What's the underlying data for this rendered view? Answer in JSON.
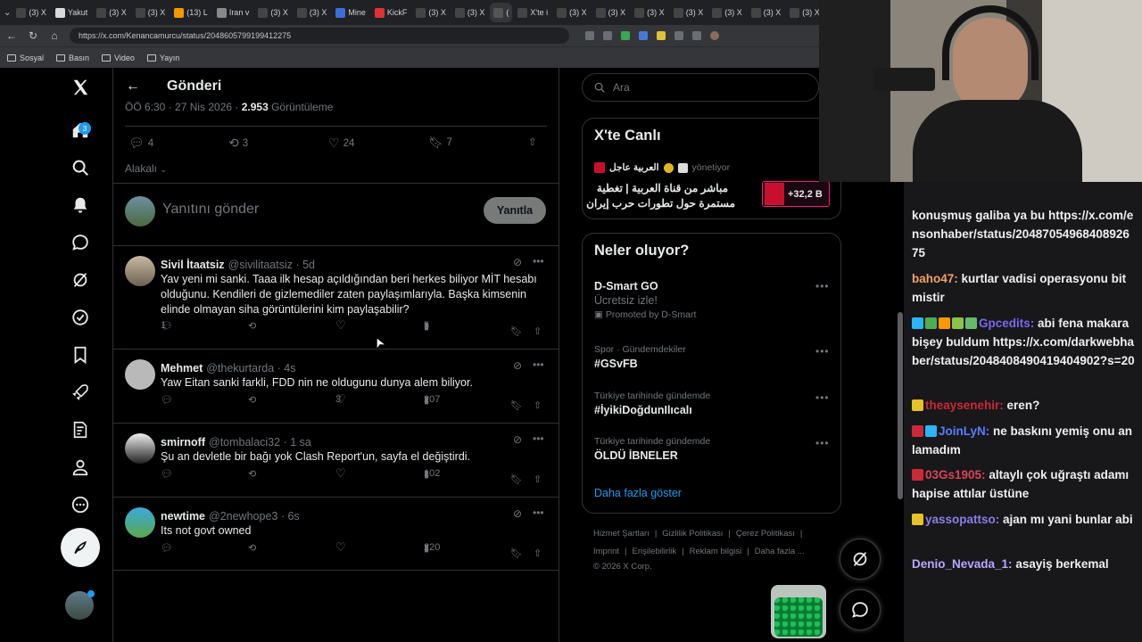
{
  "browser": {
    "tabs": [
      {
        "label": "(3) X"
      },
      {
        "label": "Yakut"
      },
      {
        "label": "(3) X"
      },
      {
        "label": "(3) X"
      },
      {
        "label": "(13) L"
      },
      {
        "label": "Iran v"
      },
      {
        "label": "(3) X"
      },
      {
        "label": "(3) X"
      },
      {
        "label": "Mine"
      },
      {
        "label": "KickF"
      },
      {
        "label": "(3) X"
      },
      {
        "label": "(3) X"
      },
      {
        "label": "("
      },
      {
        "label": "X'te i"
      },
      {
        "label": "(3) X"
      },
      {
        "label": "(3) X"
      },
      {
        "label": "(3) X"
      },
      {
        "label": "(3) X"
      },
      {
        "label": "(3) X"
      },
      {
        "label": "(3) X"
      },
      {
        "label": "(3) X"
      }
    ],
    "url": "https://x.com/Kenancamurcu/status/2048605799199412275",
    "bookmarks": [
      "Sosyal",
      "Basın",
      "Video",
      "Yayın"
    ]
  },
  "nav": {
    "notification_count": "3"
  },
  "post": {
    "header_title": "Gönderi",
    "meta": "ÖÖ 6:30 · 27 Nis 2026 · ",
    "views_count": "2.953",
    "views_label": " Görüntüleme",
    "replies": "4",
    "reposts": "3",
    "likes": "24",
    "bookmarks": "7",
    "sort_label": "Alakalı",
    "reply_placeholder": "Yanıtını gönder",
    "reply_button": "Yanıtla"
  },
  "replies": [
    {
      "name": "Sivil İtaatsiz",
      "handle": "@sivilitaatsiz · 5d",
      "lines": [
        "Yav yeni mi sanki. Taaa ilk hesap açıldığından beri herkes biliyor MİT hesabı",
        "olduğunu. Kendileri de gizlemediler zaten paylaşımlarıyla. Başka kimsenin",
        "elinde olmayan siha görüntülerini kim paylaşabilir?"
      ],
      "replies": "1",
      "likes": "",
      "views": "5"
    },
    {
      "name": "Mehmet",
      "handle": "@thekurtarda · 4s",
      "lines": [
        "Yaw Eitan sanki farkli, FDD nin ne oldugunu dunya alem biliyor."
      ],
      "replies": "",
      "likes": "3",
      "views": "207"
    },
    {
      "name": "smirnoff",
      "handle": "@tombalaci32 · 1 sa",
      "lines": [
        "Şu an devletle bir bağı yok Clash Report'un, sayfa el değiştirdi."
      ],
      "replies": "",
      "likes": "",
      "views": "102"
    },
    {
      "name": "newtime",
      "handle": "@2newhope3 · 6s",
      "lines": [
        "Its not govt owned"
      ],
      "replies": "",
      "likes": "",
      "views": "220"
    }
  ],
  "sidebar": {
    "search_placeholder": "Ara",
    "live_title": "X'te Canlı",
    "live_channel": "العربية عاجل",
    "live_status": "yönetiyor",
    "live_line1": "مباشر من قناة العربية | تغطية",
    "live_line2": "مستمرة حول تطورات حرب إيران",
    "live_count": "+32,2 B",
    "happening_title": "Neler oluyor?",
    "trends": [
      {
        "context": "",
        "title": "D-Smart GO",
        "sub": "Ücretsiz izle!",
        "promo": "Promoted by D-Smart"
      },
      {
        "context": "Spor · Gündemdekiler",
        "title": "#GSvFB",
        "sub": "",
        "promo": ""
      },
      {
        "context": "Türkiye tarihinde gündemde",
        "title": "#İyikiDoğdunIlıcalı",
        "sub": "",
        "promo": ""
      },
      {
        "context": "Türkiye tarihinde gündemde",
        "title": "ÖLDÜ İBNELER",
        "sub": "",
        "promo": ""
      }
    ],
    "show_more": "Daha fazla göster",
    "footer_line1": [
      "Hizmet Şartları",
      "|",
      "Gizlilik Politikası",
      "|",
      "Çerez Politikası",
      "|"
    ],
    "footer_line2": [
      "Imprint",
      "|",
      "Erişilebilirlik",
      "|",
      "Reklam bilgisi",
      "|",
      "Daha fazla ..."
    ],
    "copyright": "© 2026 X Corp."
  },
  "chat": {
    "messages": [
      {
        "user": "",
        "text": "konuşmuş galiba ya bu https://x.com/ensonhaber/status/2048705496840892675",
        "color": "#efeff1"
      },
      {
        "user": "baho47:",
        "text": " kurtlar vadisi operasyonu bitmistir",
        "color": "#f0a35e"
      },
      {
        "user": "Gpcedits:",
        "text": " abi fena makara bişey buldum https://x.com/darkwebhaber/status/2048408490419404902?s=20",
        "color": "#7b68ee"
      },
      {
        "user": "theaysenehir:",
        "text": " eren?",
        "color": "#cc2936"
      },
      {
        "user": "JoinLyN:",
        "text": " ne baskını yemiş onu anlamadım",
        "color": "#5b7cff"
      },
      {
        "user": "03Gs1905:",
        "text": " altaylı çok uğraştı adamı hapise attılar üstüne",
        "color": "#d9445a"
      },
      {
        "user": "yassopattso:",
        "text": " ajan mı yani bunlar abi",
        "color": "#8a7ee8"
      },
      {
        "user": "Denio_Nevada_1:",
        "text": " asayiş berkemal",
        "color": "#b9a7ff"
      }
    ]
  },
  "colors": {
    "accent": "#1d9bf0",
    "muted": "#71767b",
    "border": "#2f3336",
    "live_red": "#f91880"
  }
}
